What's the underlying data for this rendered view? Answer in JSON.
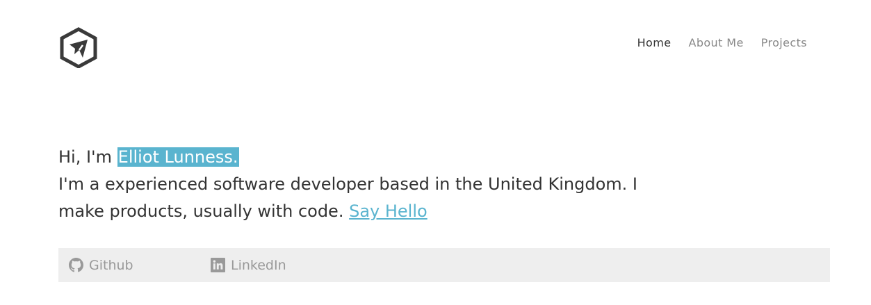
{
  "logo": {
    "icon": "hexagon-plane-logo",
    "color": "#333333"
  },
  "nav": {
    "items": [
      {
        "label": "Home",
        "active": true
      },
      {
        "label": "About Me",
        "active": false
      },
      {
        "label": "Projects",
        "active": false
      }
    ]
  },
  "intro": {
    "greeting_prefix": "Hi, I'm ",
    "name": "Elliot Lunness.",
    "description": "I'm a experienced software developer based in the United Kingdom. I make products, usually with code.",
    "cta_label": "Say Hello"
  },
  "social": {
    "github_label": "Github",
    "github_icon": "github-icon",
    "linkedin_label": "LinkedIn",
    "linkedin_icon": "linkedin-icon"
  },
  "colors": {
    "accent": "#5ab4cf",
    "text": "#333333",
    "muted": "#888888",
    "bar_background": "#eeeeee"
  }
}
